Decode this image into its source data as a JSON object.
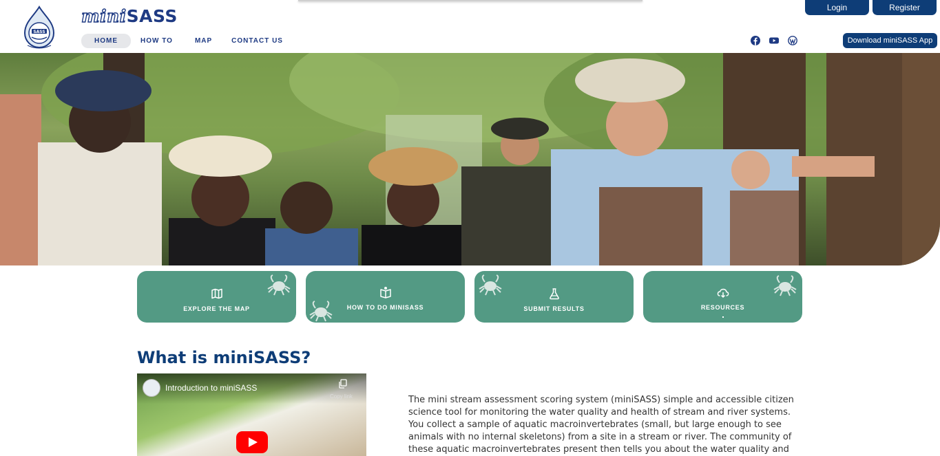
{
  "brand": {
    "mini": "mini",
    "sass": "SASS"
  },
  "nav": [
    {
      "label": "HOME",
      "active": true
    },
    {
      "label": "HOW TO",
      "active": false
    },
    {
      "label": "MAP",
      "active": false
    },
    {
      "label": "CONTACT US",
      "active": false
    }
  ],
  "auth": {
    "login": "Login",
    "register": "Register"
  },
  "social": [
    "facebook-icon",
    "youtube-icon",
    "wordpress-icon"
  ],
  "download_label": "Download miniSASS App",
  "cards": [
    {
      "label": "EXPLORE THE MAP",
      "icon": "map-icon"
    },
    {
      "label": "HOW TO DO MINISASS",
      "icon": "book-icon"
    },
    {
      "label": "SUBMIT RESULTS",
      "icon": "flask-icon"
    },
    {
      "label": "RESOURCES",
      "icon": "cloud-download-icon"
    }
  ],
  "section_title": "What is miniSASS?",
  "video": {
    "title": "Introduction to miniSASS",
    "copy_label": "Copy link"
  },
  "description": "The mini stream assessment scoring system (miniSASS) simple and accessible citizen science tool for monitoring the water quality and health of stream and river systems. You collect a sample of aquatic macroinvertebrates (small, but large enough to see animals with no internal skeletons) from a site in a stream or river. The community of these aquatic macroinvertebrates present then tells you about the water quality and",
  "colors": {
    "brand_blue": "#0e3d77",
    "card_green": "#539a84",
    "nav_text": "#1e3a83"
  }
}
